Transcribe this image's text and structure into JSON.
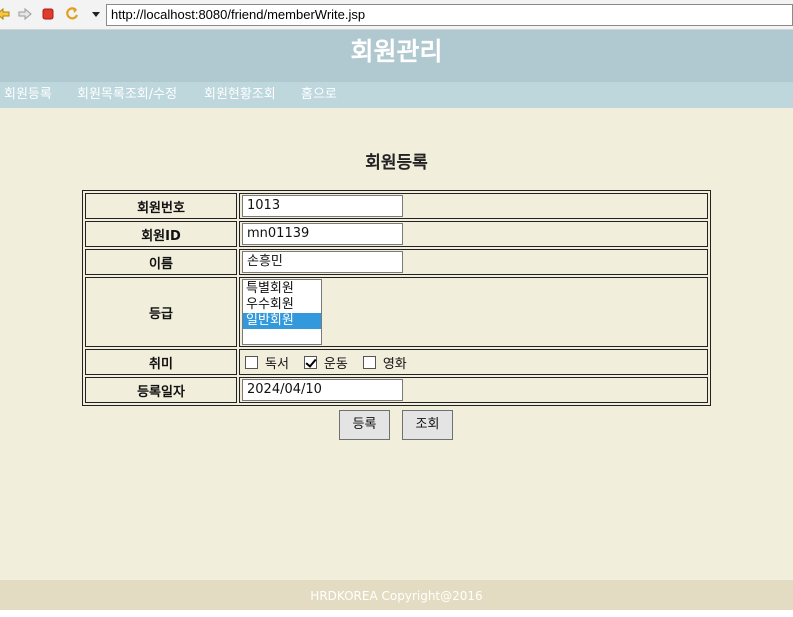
{
  "browser": {
    "url": "http://localhost:8080/friend/memberWrite.jsp",
    "icons": [
      "back-arrow-icon",
      "forward-arrow-icon",
      "stop-icon",
      "refresh-icon",
      "dropdown-arrow-icon"
    ]
  },
  "header": {
    "title": "회원관리"
  },
  "nav": {
    "items": [
      {
        "label": "회원등록"
      },
      {
        "label": "회원목록조회/수정"
      },
      {
        "label": "회원현황조회"
      },
      {
        "label": "홈으로"
      }
    ]
  },
  "main": {
    "title": "회원등록",
    "fields": {
      "member_no": {
        "label": "회원번호",
        "value": "1013"
      },
      "member_id": {
        "label": "회원ID",
        "value": "mn01139"
      },
      "name": {
        "label": "이름",
        "value": "손흥민"
      },
      "grade": {
        "label": "등급",
        "options": [
          "특별회원",
          "우수회원",
          "일반회원"
        ],
        "selected": "일반회원"
      },
      "hobby": {
        "label": "취미",
        "options": [
          {
            "label": "독서",
            "checked": false
          },
          {
            "label": "운동",
            "checked": true
          },
          {
            "label": "영화",
            "checked": false
          }
        ]
      },
      "reg_date": {
        "label": "등록일자",
        "value": "2024/04/10"
      }
    },
    "buttons": {
      "register": "등록",
      "lookup": "조회"
    }
  },
  "footer": {
    "text": "HRDKOREA Copyright@2016"
  },
  "colors": {
    "header_bg": "#b0c8d0",
    "nav_bg": "#bdd7dd",
    "main_bg": "#f1eedc",
    "footer_bg": "#e4dcc2",
    "selected_option": "#3399dd"
  }
}
